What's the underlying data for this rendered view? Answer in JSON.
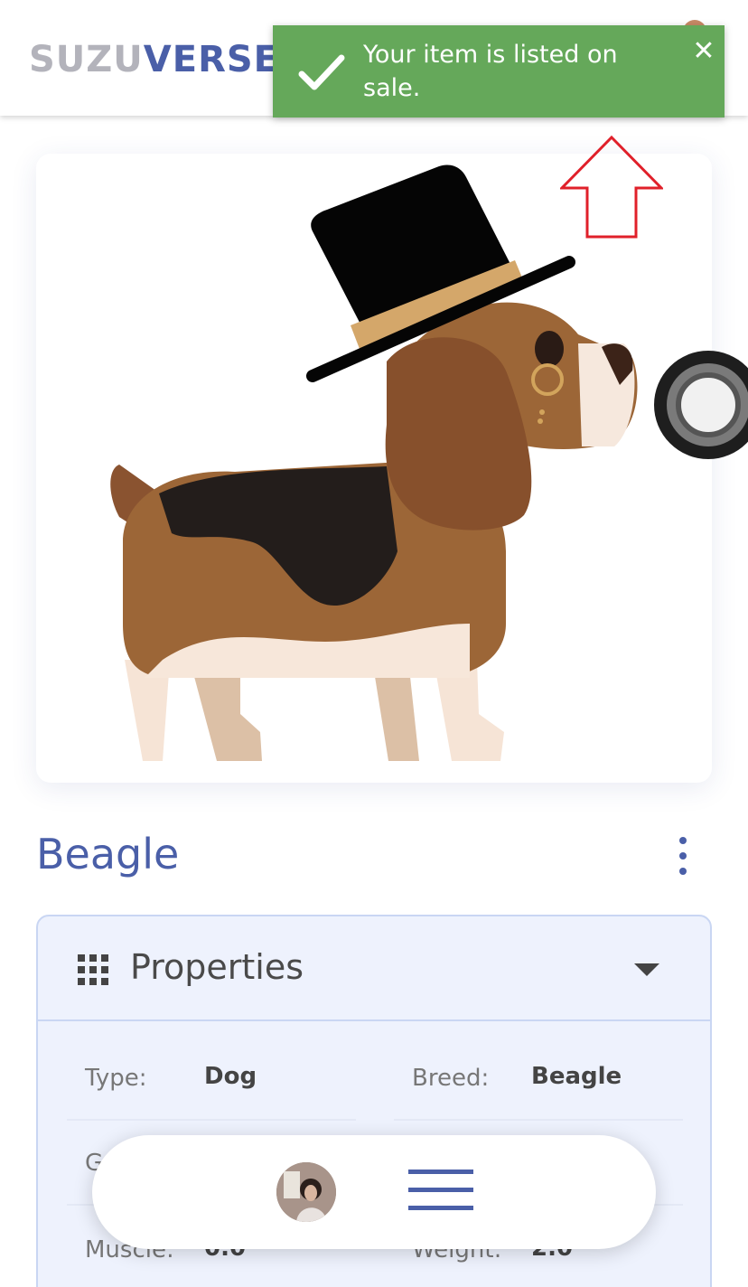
{
  "header": {
    "logo_part1": "SUZU",
    "logo_part2": "VERSE"
  },
  "toast": {
    "message": "Your item is listed on sale.",
    "close_glyph": "✕",
    "color": "#65a85a"
  },
  "item": {
    "title": "Beagle"
  },
  "properties": {
    "heading": "Properties",
    "rows": [
      {
        "label": "Type:",
        "value": "Dog"
      },
      {
        "label": "Breed:",
        "value": "Beagle"
      },
      {
        "label": "G",
        "value": ""
      },
      {
        "label": "Muscle:",
        "value": "0.0"
      },
      {
        "label": "Weight:",
        "value": "2.0"
      }
    ]
  },
  "colors": {
    "brand_blue": "#4a5fa8",
    "arrow_red": "#e0202a"
  },
  "icons": {
    "toast_icon": "checkmark-icon",
    "grid": "grid-icon",
    "menu": "hamburger-icon"
  }
}
